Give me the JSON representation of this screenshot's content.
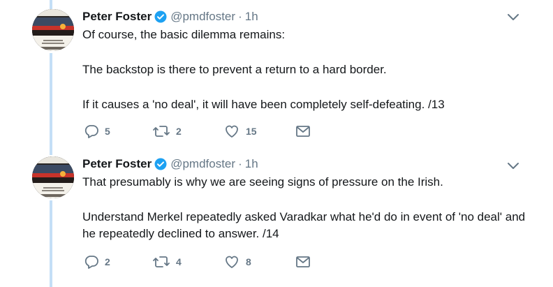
{
  "tweets": [
    {
      "author_name": "Peter Foster",
      "handle": "@pmdfoster",
      "separator": "·",
      "time": "1h",
      "paragraphs": [
        "Of course, the basic dilemma remains:",
        "The backstop is there to prevent a return to a hard border.",
        "If it causes a 'no deal', it will have been completely self-defeating. /13"
      ],
      "replies": "5",
      "retweets": "2",
      "likes": "15"
    },
    {
      "author_name": "Peter Foster",
      "handle": "@pmdfoster",
      "separator": "·",
      "time": "1h",
      "paragraphs": [
        "That presumably is why we are seeing signs of pressure on the Irish.",
        "Understand Merkel repeatedly asked Varadkar what he'd do in event of 'no deal' and he repeatedly declined to answer. /14"
      ],
      "replies": "2",
      "retweets": "4",
      "likes": "8"
    }
  ],
  "colors": {
    "thread_line": "#c4dff6",
    "verified": "#1da1f2",
    "muted": "#657786",
    "text": "#14171a"
  },
  "icons": [
    "verified-badge-icon",
    "chevron-down-icon",
    "reply-icon",
    "retweet-icon",
    "like-icon",
    "direct-message-icon"
  ]
}
